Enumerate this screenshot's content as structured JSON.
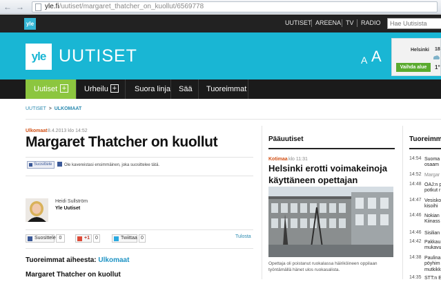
{
  "browser": {
    "url_host": "yle.fi",
    "url_path": "/uutiset/margaret_thatcher_on_kuollut/6569778",
    "back_icon": "arrow-left-icon",
    "forward_icon": "arrow-right-icon"
  },
  "topbar": {
    "logo": "yle",
    "links": [
      "UUTISET",
      "AREENA",
      "TV",
      "RADIO"
    ],
    "search_placeholder": "Hae Uutisista"
  },
  "header": {
    "logo": "yle",
    "brand": "UUTISET",
    "font_small": "A",
    "font_large": "A",
    "weather": {
      "city": "Helsinki",
      "temp": "18",
      "degree": "1°",
      "button": "Vaihda alue"
    }
  },
  "nav": {
    "items": [
      "Uutiset",
      "Urheilu",
      "Suora linja",
      "Sää",
      "Tuoreimmat"
    ],
    "plus": "+",
    "active_color": "#8cc63f"
  },
  "breadcrumb": {
    "root": "UUTISET",
    "separator": ">",
    "current": "ULKOMAAT"
  },
  "article": {
    "category": "Ulkomaat",
    "date": "8.4.2013 klo 14:52",
    "title": "Margaret Thatcher on kuollut",
    "like_label": "Suosittele",
    "like_text": "Ole kavereistasi ensimmäinen, joka suosittelee tätä.",
    "author_name": "Heidi Sullström",
    "author_org": "Yle Uutiset",
    "share": {
      "facebook_label": "Suosittele",
      "facebook_count": "0",
      "gplus_label": "+1",
      "gplus_count": "0",
      "twitter_label": "Twiittaa",
      "twitter_count": "0",
      "print": "Tulosta"
    },
    "related_label": "Tuoreimmat aiheesta:",
    "related_topic": "Ulkomaat",
    "subtitle": "Margaret Thatcher on kuollut"
  },
  "paauutiset": {
    "title": "Pääuutiset",
    "category": "Kotimaa",
    "time": "klo 11:31",
    "headline": "Helsinki erotti voimakeinoja käyttäneen opettajan",
    "caption": "Opettaja oli poistanut ruokalassa häiriköineen oppilaan työntämällä hänet ulos ruokasalista."
  },
  "tuoreimmat": {
    "title": "Tuoreimmat",
    "items": [
      {
        "time": "14:54",
        "line1": "Suoma",
        "line2": "osaam"
      },
      {
        "time": "14:52",
        "line1": "Margar",
        "line2": ""
      },
      {
        "time": "14:48",
        "line1": "OAJ:n p",
        "line2": "potkut r"
      },
      {
        "time": "14:47",
        "line1": "Vesisko",
        "line2": "kisoihi"
      },
      {
        "time": "14:46",
        "line1": "Nokian",
        "line2": "Kiinass"
      },
      {
        "time": "14:46",
        "line1": "Sisilian",
        "line2": ""
      },
      {
        "time": "14:42",
        "line1": "Pakkau",
        "line2": "mukavu"
      },
      {
        "time": "14:38",
        "line1": "Paulina",
        "line2": "pöyhim"
      },
      {
        "time": "",
        "line1": "mutkikk",
        "line2": ""
      },
      {
        "time": "14:35",
        "line1": "STT:n E",
        "line2": ""
      }
    ]
  }
}
